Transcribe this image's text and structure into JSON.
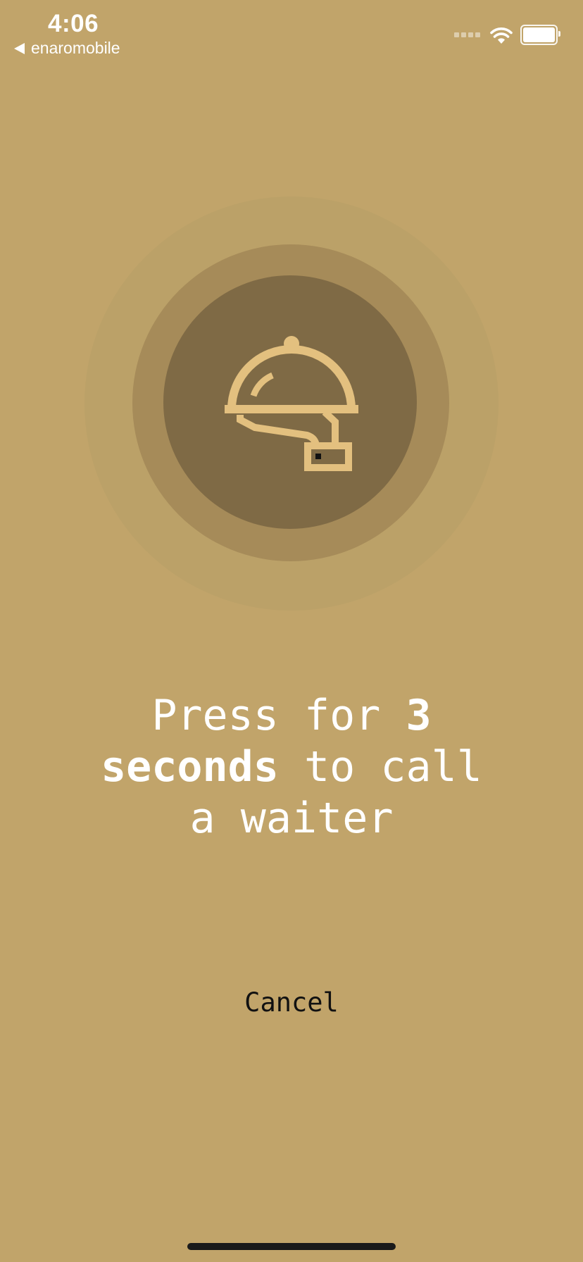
{
  "status_bar": {
    "time": "4:06",
    "back_app": "enaromobile",
    "signal_icon": "cellular-signal-icon",
    "wifi_icon": "wifi-icon",
    "battery_icon": "battery-icon",
    "battery_level": 1.0
  },
  "call_button": {
    "icon": "cloche-serving-hand-icon",
    "colors": {
      "outer_ring": "#bba168",
      "middle_ring": "#a68b59",
      "inner_circle": "#7f6a45",
      "icon": "#e3c07f"
    }
  },
  "instruction": {
    "part1": "Press for ",
    "emphasis_number": "3",
    "emphasis_word": "seconds",
    "part2": " to call",
    "part3": "a waiter"
  },
  "cancel_label": "Cancel",
  "theme": {
    "background": "#c1a46a",
    "text": "#ffffff"
  }
}
